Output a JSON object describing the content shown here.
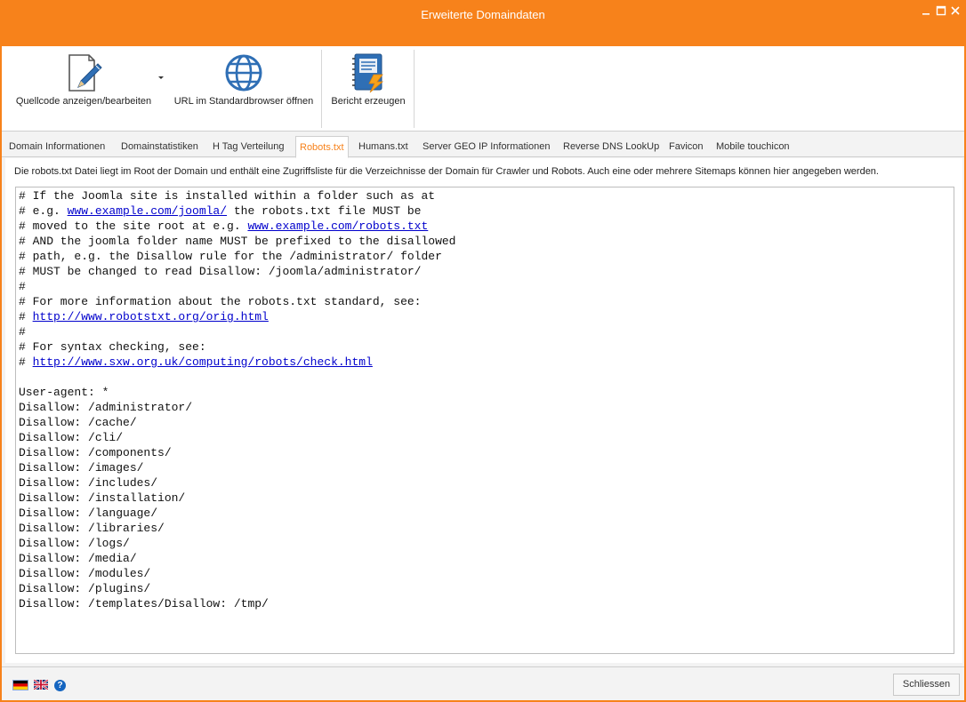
{
  "window": {
    "title": "Erweiterte Domaindaten",
    "controls": [
      "minimize-icon",
      "maximize-icon",
      "close-icon"
    ]
  },
  "ribbon": {
    "buttons": [
      {
        "label": "Quellcode anzeigen/bearbeiten",
        "icon": "edit-document-icon",
        "has_dropdown": true
      },
      {
        "label": "URL im Standardbrowser öffnen",
        "icon": "globe-icon"
      },
      {
        "label": "Bericht erzeugen",
        "icon": "report-notebook-icon"
      }
    ]
  },
  "tabs": [
    {
      "label": "Domain Informationen"
    },
    {
      "label": "Domainstatistiken"
    },
    {
      "label": "H Tag Verteilung"
    },
    {
      "label": "Robots.txt",
      "active": true
    },
    {
      "label": "Humans.txt"
    },
    {
      "label": "Server GEO IP Informationen"
    },
    {
      "label": "Reverse DNS LookUp"
    },
    {
      "label": "Favicon"
    },
    {
      "label": "Mobile touchicon"
    }
  ],
  "panel": {
    "description": "Die robots.txt Datei liegt im Root der Domain und enthält eine Zugriffsliste für die Verzeichnisse der Domain für Crawler und Robots. Auch eine oder mehrere Sitemaps können hier angegeben werden.",
    "robots_lines": [
      [
        {
          "t": "# If the Joomla site is installed within a folder such as at"
        }
      ],
      [
        {
          "t": "# e.g. "
        },
        {
          "t": "www.example.com/joomla/",
          "link": true
        },
        {
          "t": " the robots.txt file MUST be"
        }
      ],
      [
        {
          "t": "# moved to the site root at e.g. "
        },
        {
          "t": "www.example.com/robots.txt",
          "link": true
        }
      ],
      [
        {
          "t": "# AND the joomla folder name MUST be prefixed to the disallowed"
        }
      ],
      [
        {
          "t": "# path, e.g. the Disallow rule for the /administrator/ folder"
        }
      ],
      [
        {
          "t": "# MUST be changed to read Disallow: /joomla/administrator/"
        }
      ],
      [
        {
          "t": "#"
        }
      ],
      [
        {
          "t": "# For more information about the robots.txt standard, see:"
        }
      ],
      [
        {
          "t": "# "
        },
        {
          "t": "http://www.robotstxt.org/orig.html",
          "link": true
        }
      ],
      [
        {
          "t": "#"
        }
      ],
      [
        {
          "t": "# For syntax checking, see:"
        }
      ],
      [
        {
          "t": "# "
        },
        {
          "t": "http://www.sxw.org.uk/computing/robots/check.html",
          "link": true
        }
      ],
      [
        {
          "t": ""
        }
      ],
      [
        {
          "t": "User-agent: *"
        }
      ],
      [
        {
          "t": "Disallow: /administrator/"
        }
      ],
      [
        {
          "t": "Disallow: /cache/"
        }
      ],
      [
        {
          "t": "Disallow: /cli/"
        }
      ],
      [
        {
          "t": "Disallow: /components/"
        }
      ],
      [
        {
          "t": "Disallow: /images/"
        }
      ],
      [
        {
          "t": "Disallow: /includes/"
        }
      ],
      [
        {
          "t": "Disallow: /installation/"
        }
      ],
      [
        {
          "t": "Disallow: /language/"
        }
      ],
      [
        {
          "t": "Disallow: /libraries/"
        }
      ],
      [
        {
          "t": "Disallow: /logs/"
        }
      ],
      [
        {
          "t": "Disallow: /media/"
        }
      ],
      [
        {
          "t": "Disallow: /modules/"
        }
      ],
      [
        {
          "t": "Disallow: /plugins/"
        }
      ],
      [
        {
          "t": "Disallow: /templates/Disallow: /tmp/"
        }
      ]
    ]
  },
  "statusbar": {
    "flags": [
      "german-flag-icon",
      "uk-flag-icon"
    ],
    "help_icon": "help-icon",
    "help_label": "?",
    "close_label": "Schliessen"
  },
  "colors": {
    "accent": "#f7821b",
    "link": "#0000cc"
  }
}
